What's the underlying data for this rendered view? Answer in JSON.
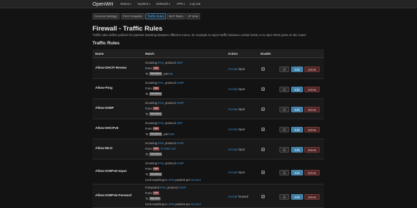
{
  "header": {
    "brand": "OpenWrt",
    "menu": [
      {
        "label": "Status",
        "caret": "▾"
      },
      {
        "label": "System",
        "caret": "▾"
      },
      {
        "label": "Network",
        "caret": "▾"
      },
      {
        "label": "VPN",
        "caret": "▾"
      },
      {
        "label": "Log out",
        "caret": ""
      }
    ]
  },
  "tabs": [
    {
      "label": "General Settings",
      "active": false
    },
    {
      "label": "Port Forwards",
      "active": false
    },
    {
      "label": "Traffic Rules",
      "active": true
    },
    {
      "label": "NAT Rules",
      "active": false
    },
    {
      "label": "IP Sets",
      "active": false
    }
  ],
  "page": {
    "title": "Firewall - Traffic Rules",
    "description": "Traffic rules define policies for packets traveling between different zones, for example to reject traffic between certain hosts or to open WAN ports on the router.",
    "section_title": "Traffic Rules"
  },
  "table": {
    "columns": [
      "Name",
      "Match",
      "Action",
      "Enable"
    ],
    "buttons": {
      "drag": "☰",
      "edit": "Edit",
      "delete": "Delete"
    },
    "rows": [
      {
        "name": "Allow-DHCP-Renew",
        "lines": {
          "l1a": "Incoming ",
          "l1b": "IPv4",
          "l1c": ", protocol ",
          "l1d": "UDP",
          "l2a": "From ",
          "l2b": "wan",
          "l3a": "To ",
          "l3b": "this device",
          "l3c": ", port ",
          "l3d": "68"
        },
        "action": {
          "verb": "Accept",
          "rest": " input"
        },
        "enabled": "✓"
      },
      {
        "name": "Allow-Ping",
        "lines": {
          "l1a": "Incoming ",
          "l1b": "IPv4",
          "l1c": ", protocol ",
          "l1d": "ICMP",
          "l2a": "From ",
          "l2b": "wan",
          "l3a": "To ",
          "l3b": "this device",
          "l3c": "",
          "l3d": ""
        },
        "action": {
          "verb": "Accept",
          "rest": " input"
        },
        "enabled": "✓"
      },
      {
        "name": "Allow-IGMP",
        "lines": {
          "l1a": "Incoming ",
          "l1b": "IPv4",
          "l1c": ", protocol ",
          "l1d": "IGMP",
          "l2a": "From ",
          "l2b": "wan",
          "l3a": "To ",
          "l3b": "this device",
          "l3c": "",
          "l3d": ""
        },
        "action": {
          "verb": "Accept",
          "rest": " input"
        },
        "enabled": "✓"
      },
      {
        "name": "Allow-DHCPv6",
        "lines": {
          "l1a": "Incoming ",
          "l1b": "IPv6",
          "l1c": ", protocol ",
          "l1d": "UDP",
          "l2a": "From ",
          "l2b": "wan",
          "l3a": "To ",
          "l3b": "this device",
          "l3c": ", port ",
          "l3d": "546"
        },
        "action": {
          "verb": "Accept",
          "rest": " input"
        },
        "enabled": "✓"
      },
      {
        "name": "Allow-MLD",
        "lines": {
          "l1a": "Incoming ",
          "l1b": "IPv6",
          "l1c": ", protocol ",
          "l1d": "ICMP",
          "l2a": "From ",
          "l2b": "wan",
          "l2c": ", ",
          "l2d": "IP",
          "l2e": " ",
          "l2f": "fe80::/10",
          "l3a": "To ",
          "l3b": "this device",
          "l3c": "",
          "l3d": ""
        },
        "action": {
          "verb": "Accept",
          "rest": " input"
        },
        "enabled": "✓"
      },
      {
        "name": "Allow-ICMPv6-Input",
        "lines": {
          "l1a": "Incoming ",
          "l1b": "IPv6",
          "l1c": ", protocol ",
          "l1d": "ICMP",
          "l2a": "From ",
          "l2b": "wan",
          "l3a": "To ",
          "l3b": "this device",
          "l3c": "",
          "l3d": "",
          "l4a": "Limit matching to ",
          "l4b": "1000",
          "l4c": " packets per ",
          "l4d": "second"
        },
        "action": {
          "verb": "Accept",
          "rest": " input"
        },
        "enabled": "✓"
      },
      {
        "name": "Allow-ICMPv6-Forward",
        "lines": {
          "l1a": "Forwarded ",
          "l1b": "IPv6",
          "l1c": ", protocol ",
          "l1d": "ICMP",
          "l2a": "From ",
          "l2b": "wan",
          "l3a": "To ",
          "l3b": "any zone",
          "l3c": "",
          "l3d": "",
          "l4a": "Limit matching to ",
          "l4b": "1000",
          "l4c": " packets per ",
          "l4d": "second"
        },
        "action": {
          "verb": "Accept",
          "rest": " forward"
        },
        "enabled": "✓"
      }
    ]
  }
}
